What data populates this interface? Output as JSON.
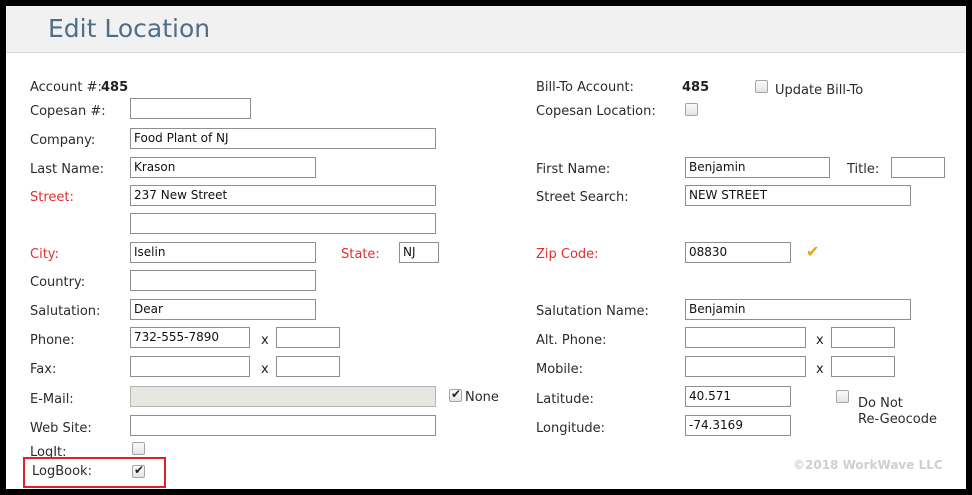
{
  "page_title": "Edit Location",
  "left": {
    "account_label": "Account #:",
    "account_value": "485",
    "copesan_label": "Copesan #:",
    "copesan_value": "",
    "company_label": "Company:",
    "company_value": "Food Plant of NJ",
    "last_name_label": "Last Name:",
    "last_name_value": "Krason",
    "street_label": "Street:",
    "street_value": "237 New Street",
    "street2_value": "",
    "city_label": "City:",
    "city_value": "Iselin",
    "state_label": "State:",
    "state_value": "NJ",
    "country_label": "Country:",
    "country_value": "",
    "salutation_label": "Salutation:",
    "salutation_value": "Dear",
    "phone_label": "Phone:",
    "phone_value": "732-555-7890",
    "phone_ext_label": "x",
    "phone_ext_value": "",
    "fax_label": "Fax:",
    "fax_value": "",
    "fax_ext_label": "x",
    "fax_ext_value": "",
    "email_label": "E-Mail:",
    "email_value": "",
    "none_label": "None",
    "none_checked": true,
    "website_label": "Web Site:",
    "website_value": "",
    "logit_label": "LogIt:",
    "logit_checked": false,
    "logbook_label": "LogBook:",
    "logbook_checked": true
  },
  "right": {
    "billto_label": "Bill-To Account:",
    "billto_value": "485",
    "update_billto_label": "Update Bill-To",
    "update_billto_checked": false,
    "copesan_location_label": "Copesan Location:",
    "copesan_location_checked": false,
    "first_name_label": "First Name:",
    "first_name_value": "Benjamin",
    "title_label": "Title:",
    "title_value": "",
    "street_search_label": "Street Search:",
    "street_search_value": "NEW STREET",
    "zip_label": "Zip Code:",
    "zip_value": "08830",
    "salutation_name_label": "Salutation Name:",
    "salutation_name_value": "Benjamin",
    "alt_phone_label": "Alt. Phone:",
    "alt_phone_value": "",
    "alt_phone_ext_label": "x",
    "alt_phone_ext_value": "",
    "mobile_label": "Mobile:",
    "mobile_value": "",
    "mobile_ext_label": "x",
    "mobile_ext_value": "",
    "latitude_label": "Latitude:",
    "latitude_value": "40.571",
    "longitude_label": "Longitude:",
    "longitude_value": "-74.3169",
    "do_not_regeocode_label_1": "Do Not",
    "do_not_regeocode_label_2": "Re-Geocode",
    "do_not_regeocode_checked": false
  },
  "footer": {
    "copyright": "©2018 WorkWave LLC"
  },
  "colors": {
    "title": "#4f6e89",
    "required_label": "#e03030",
    "highlight": "#e0202a",
    "zip_check": "#e5a21e"
  },
  "icons": {
    "zip_valid": "check-icon"
  }
}
